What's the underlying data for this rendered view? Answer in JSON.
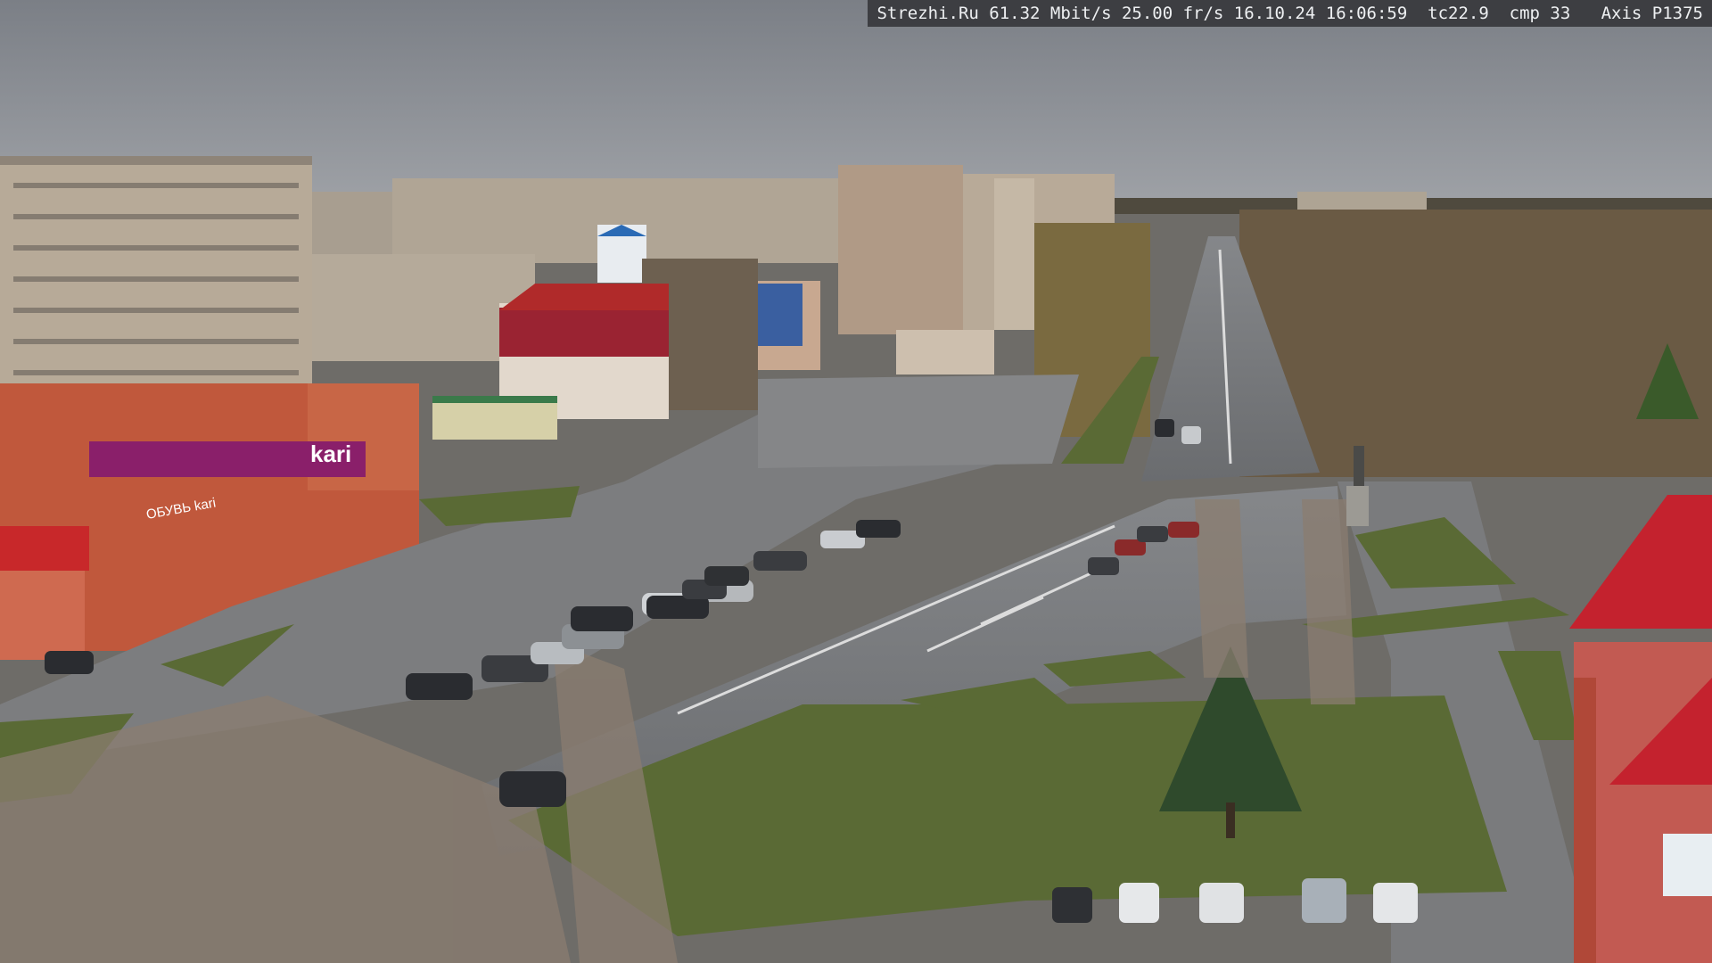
{
  "overlay": {
    "text": "Strezhi.Ru 61.32 Mbit/s 25.00 fr/s 16.10.24 16:06:59  tc22.9  cmp 33   Axis P1375"
  },
  "signs": {
    "store": "kari",
    "store_sub": "ОБУВЬ kari"
  },
  "colors": {
    "sky": "#8c9097",
    "road": "#76787a",
    "grass": "#5a6a35",
    "brick": "#c0583c",
    "panel_building": "#b7aa98",
    "roof_red": "#b02a2a",
    "store_sign": "#8a1f6a"
  }
}
